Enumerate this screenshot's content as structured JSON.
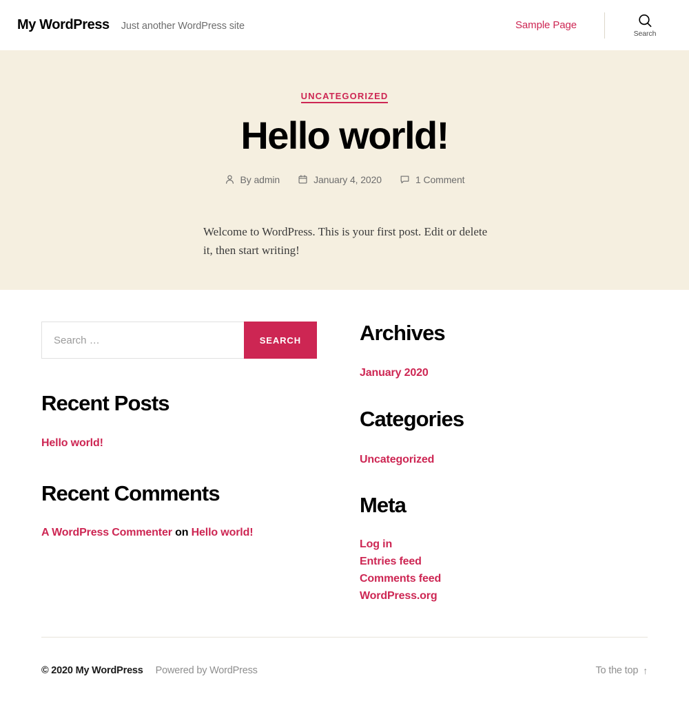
{
  "header": {
    "site_title": "My WordPress",
    "site_description": "Just another WordPress site",
    "nav": [
      {
        "label": "Sample Page",
        "name": "nav-sample-page"
      }
    ],
    "search_toggle_label": "Search",
    "search_icon": "search-icon"
  },
  "hero": {
    "background_color": "#f5efe0",
    "category": "UNCATEGORIZED",
    "title": "Hello world!",
    "meta": {
      "author_prefix": "By",
      "author": "admin",
      "author_text": "By admin",
      "author_icon": "person-icon",
      "date": "January 4, 2020",
      "date_icon": "calendar-icon",
      "comments": "1 Comment",
      "comments_icon": "comment-icon"
    },
    "excerpt": "Welcome to WordPress. This is your first post. Edit or delete it, then start writing!"
  },
  "search_widget": {
    "placeholder": "Search …",
    "value": "",
    "button_label": "SEARCH",
    "button_color": "#cd2653"
  },
  "widgets_left": [
    {
      "title": "Recent Posts",
      "name": "recent-posts",
      "items": [
        {
          "label": "Hello world!"
        }
      ]
    },
    {
      "title": "Recent Comments",
      "name": "recent-comments",
      "comment": {
        "author": "A WordPress Commenter",
        "connector": "on",
        "post": "Hello world!"
      }
    }
  ],
  "widgets_right": [
    {
      "title": "Archives",
      "name": "archives",
      "items": [
        {
          "label": "January 2020"
        }
      ]
    },
    {
      "title": "Categories",
      "name": "categories",
      "items": [
        {
          "label": "Uncategorized"
        }
      ]
    },
    {
      "title": "Meta",
      "name": "meta",
      "items": [
        {
          "label": "Log in"
        },
        {
          "label": "Entries feed"
        },
        {
          "label": "Comments feed"
        },
        {
          "label": "WordPress.org"
        }
      ]
    }
  ],
  "footer": {
    "copyright": "© 2020 My WordPress",
    "powered_by": "Powered by WordPress",
    "to_top": "To the top",
    "to_top_arrow": "↑"
  },
  "theme": {
    "accent_color": "#cd2653",
    "hero_bg": "#f5efe0",
    "text_color": "#000000",
    "muted_color": "#6d6d6d"
  }
}
